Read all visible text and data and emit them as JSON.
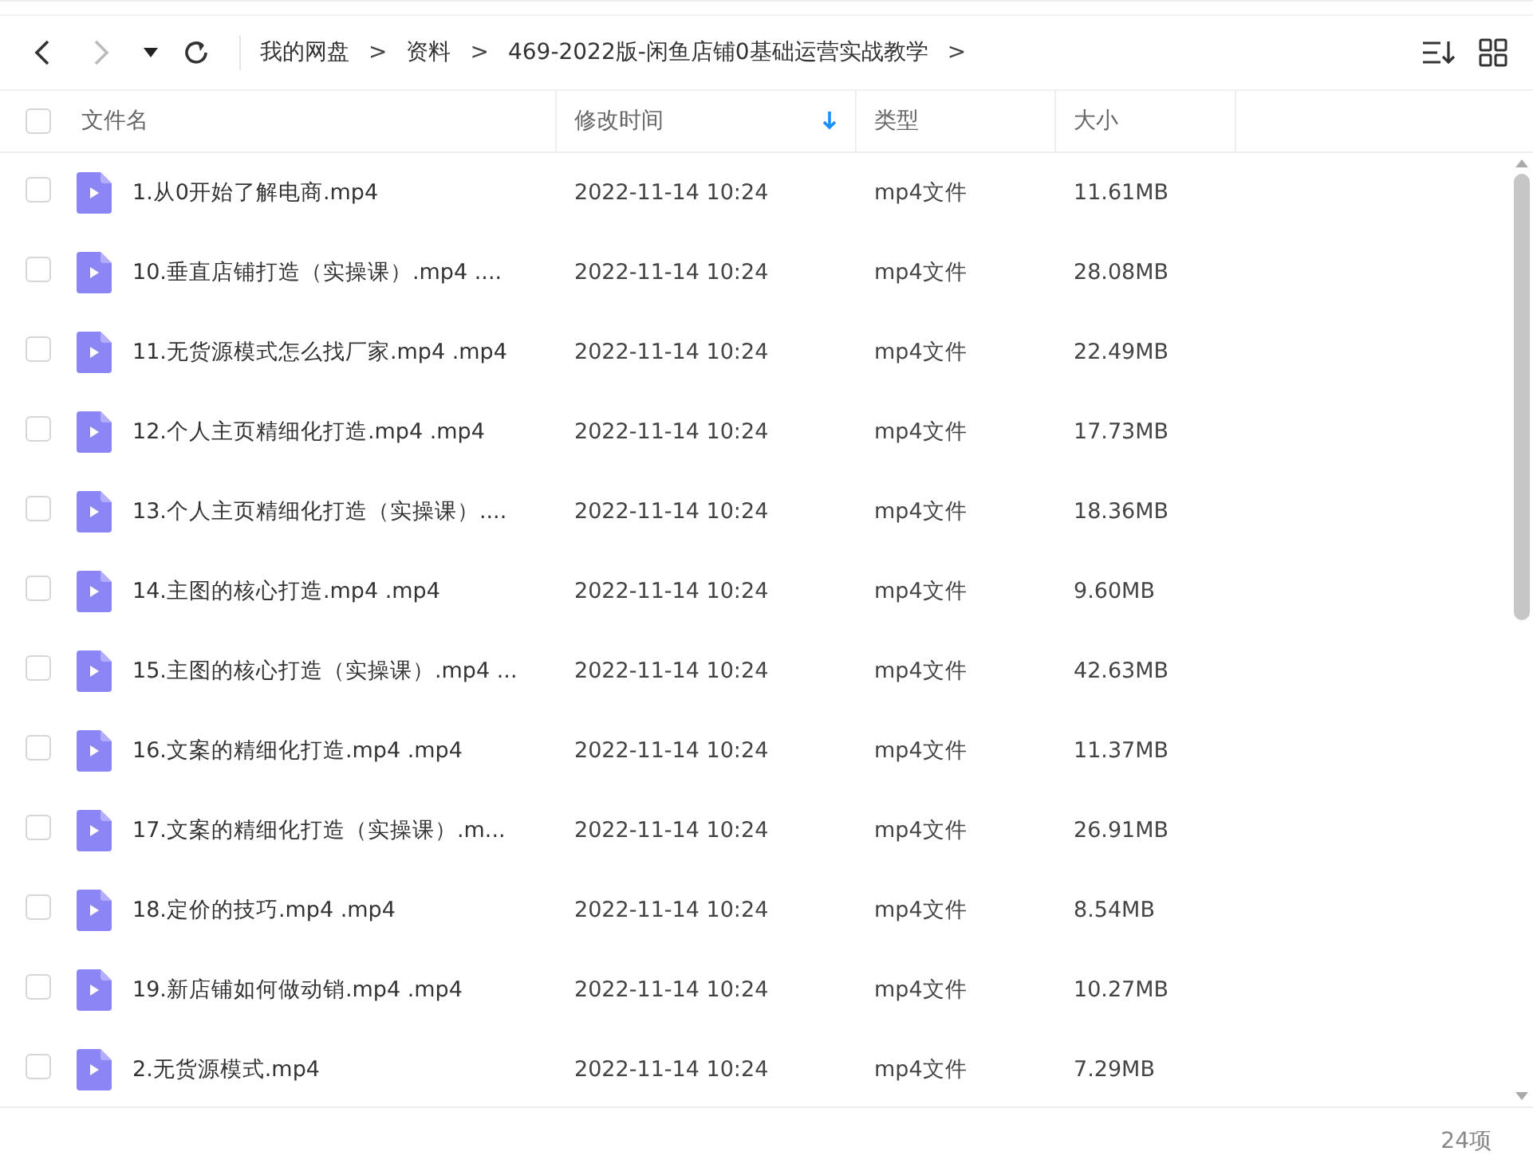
{
  "toolbar": {
    "back": {
      "disabled": false
    },
    "forward": {
      "disabled": true
    },
    "breadcrumbs": [
      {
        "kind": "crumb",
        "text": "我的网盘"
      },
      {
        "kind": "separator",
        "text": ">"
      },
      {
        "kind": "crumb",
        "text": "资料"
      },
      {
        "kind": "separator",
        "text": ">"
      },
      {
        "kind": "crumb",
        "text": "469-2022版-闲鱼店铺0基础运营实战教学"
      },
      {
        "kind": "separator",
        "text": ">"
      }
    ]
  },
  "table": {
    "select_all": {
      "checked": false
    },
    "columns": [
      {
        "label": "文件名",
        "sorted": false
      },
      {
        "label": "修改时间",
        "sorted": true
      },
      {
        "label": "类型",
        "sorted": false
      },
      {
        "label": "大小",
        "sorted": false
      }
    ],
    "rows": [
      {
        "name": "1.从0开始了解电商.mp4",
        "modified": "2022-11-14 10:24",
        "type": "mp4文件",
        "size": "11.61MB",
        "checked": false
      },
      {
        "name": "10.垂直店铺打造（实操课）.mp4 ....",
        "modified": "2022-11-14 10:24",
        "type": "mp4文件",
        "size": "28.08MB",
        "checked": false
      },
      {
        "name": "11.无货源模式怎么找厂家.mp4 .mp4",
        "modified": "2022-11-14 10:24",
        "type": "mp4文件",
        "size": "22.49MB",
        "checked": false
      },
      {
        "name": "12.个人主页精细化打造.mp4 .mp4",
        "modified": "2022-11-14 10:24",
        "type": "mp4文件",
        "size": "17.73MB",
        "checked": false
      },
      {
        "name": "13.个人主页精细化打造（实操课）....",
        "modified": "2022-11-14 10:24",
        "type": "mp4文件",
        "size": "18.36MB",
        "checked": false
      },
      {
        "name": "14.主图的核心打造.mp4 .mp4",
        "modified": "2022-11-14 10:24",
        "type": "mp4文件",
        "size": "9.60MB",
        "checked": false
      },
      {
        "name": "15.主图的核心打造（实操课）.mp4 ...",
        "modified": "2022-11-14 10:24",
        "type": "mp4文件",
        "size": "42.63MB",
        "checked": false
      },
      {
        "name": "16.文案的精细化打造.mp4 .mp4",
        "modified": "2022-11-14 10:24",
        "type": "mp4文件",
        "size": "11.37MB",
        "checked": false
      },
      {
        "name": "17.文案的精细化打造（实操课）.m...",
        "modified": "2022-11-14 10:24",
        "type": "mp4文件",
        "size": "26.91MB",
        "checked": false
      },
      {
        "name": "18.定价的技巧.mp4 .mp4",
        "modified": "2022-11-14 10:24",
        "type": "mp4文件",
        "size": "8.54MB",
        "checked": false
      },
      {
        "name": "19.新店铺如何做动销.mp4 .mp4",
        "modified": "2022-11-14 10:24",
        "type": "mp4文件",
        "size": "10.27MB",
        "checked": false
      },
      {
        "name": "2.无货源模式.mp4",
        "modified": "2022-11-14 10:24",
        "type": "mp4文件",
        "size": "7.29MB",
        "checked": false
      }
    ]
  },
  "status_bar": {
    "count": "24项"
  }
}
